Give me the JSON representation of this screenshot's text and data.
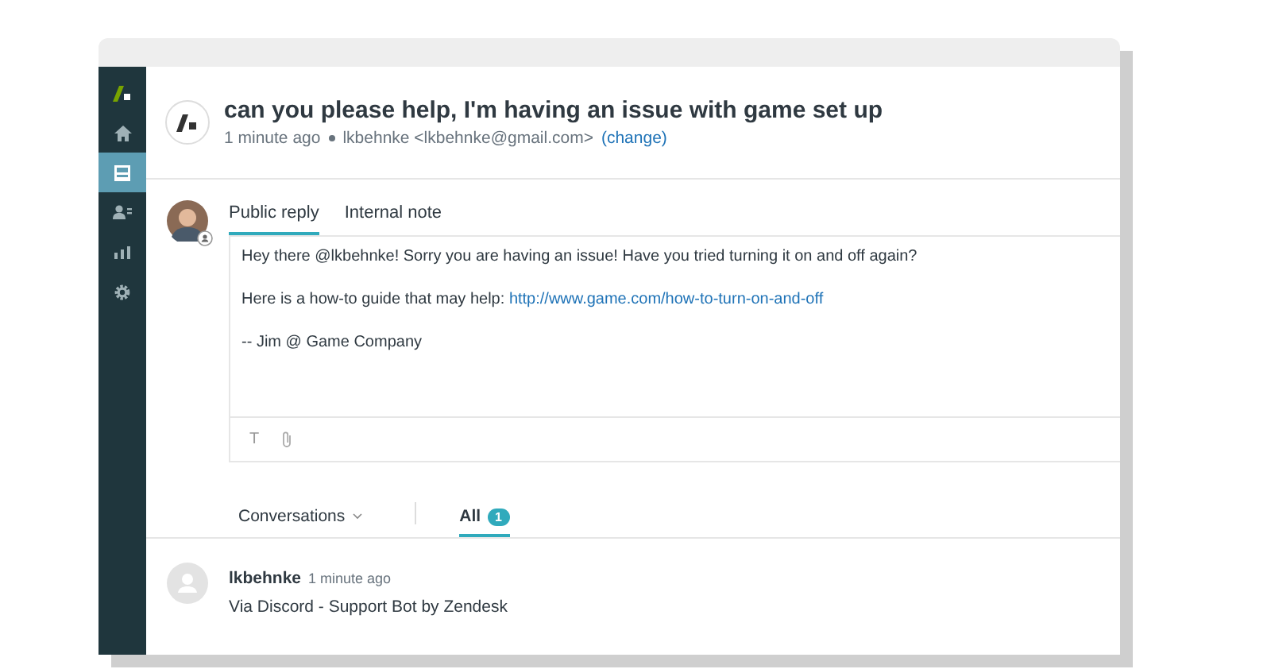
{
  "sidebar": {
    "items": [
      {
        "kind": "logo",
        "selected": false
      },
      {
        "kind": "home",
        "selected": false
      },
      {
        "kind": "tickets",
        "selected": true
      },
      {
        "kind": "users",
        "selected": false
      },
      {
        "kind": "reports",
        "selected": false
      },
      {
        "kind": "settings",
        "selected": false
      }
    ]
  },
  "ticket": {
    "title": "can you please help, I'm having an issue with game set up",
    "time": "1 minute ago",
    "requester": "lkbehnke <lkbehnke@gmail.com>",
    "change_link": "(change)"
  },
  "reply": {
    "tabs": [
      {
        "label": "Public reply",
        "selected": true
      },
      {
        "label": "Internal note",
        "selected": false
      }
    ],
    "lines": [
      {
        "text": "Hey there @lkbehnke! Sorry you are having an issue! Have you tried turning it on and off again?"
      },
      {
        "text": "Here is a how-to guide that may help: ",
        "link": "http://www.game.com/how-to-turn-on-and-off"
      },
      {
        "text": "-- Jim @ Game Company"
      }
    ],
    "toolbar": [
      {
        "kind": "text-format",
        "label": "T"
      },
      {
        "kind": "attachment"
      }
    ]
  },
  "conversations": {
    "filter": "Conversations",
    "tabs": [
      {
        "label": "All",
        "count": "1",
        "selected": true
      }
    ]
  },
  "events": [
    {
      "author": "lkbehnke",
      "time": "1 minute ago",
      "text": "Via Discord - Support Bot by Zendesk"
    }
  ]
}
